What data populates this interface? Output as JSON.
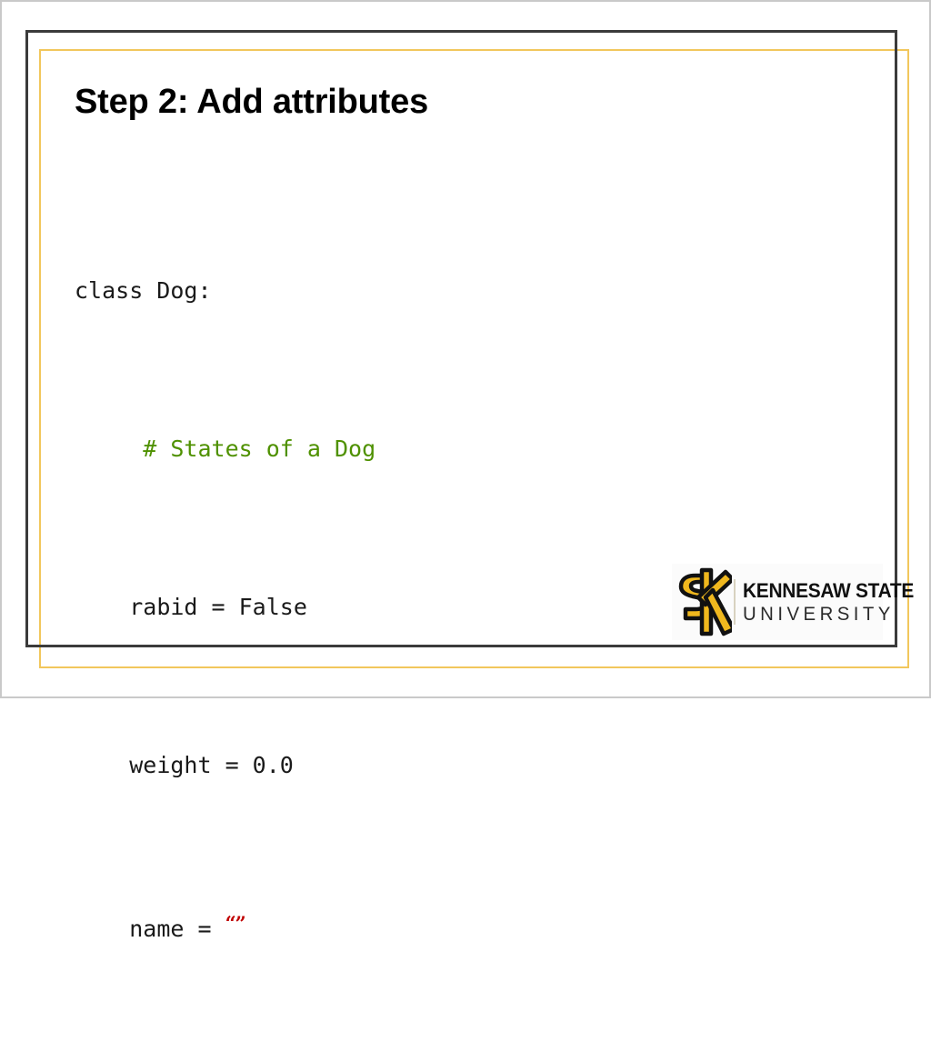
{
  "slide": {
    "title": "Step 2: Add attributes",
    "background_color": "#ffffff",
    "outer_border_color": "#c9c9c9",
    "dark_frame_color": "#3b3b3b",
    "gold_frame_color": "#f2c75c"
  },
  "code": {
    "language": "python",
    "comment_color": "#4f9100",
    "string_color": "#c00000",
    "text_color": "#1a1a1a",
    "lines": [
      {
        "indent": "",
        "text": "class Dog:",
        "kind": "code"
      },
      {
        "indent": "     ",
        "text": "# States of a Dog",
        "kind": "comment"
      },
      {
        "indent": "    ",
        "text": "rabid = False",
        "kind": "code"
      },
      {
        "indent": "    ",
        "text": "weight = 0.0",
        "kind": "code"
      },
      {
        "indent": "    ",
        "text": "name = ",
        "kind": "code",
        "string_literal": "“”"
      }
    ],
    "full_text": "class Dog:\n     # States of a Dog\n    rabid = False\n    weight = 0.0\n    name = “”"
  },
  "logo": {
    "name": "kennesaw-state-university-logo",
    "monogram_text": "KS",
    "line1": "KENNESAW STATE",
    "line2": "UNIVERSITY",
    "gold_color": "#f0b81e",
    "outline_color": "#111111",
    "text_color": "#111111"
  }
}
